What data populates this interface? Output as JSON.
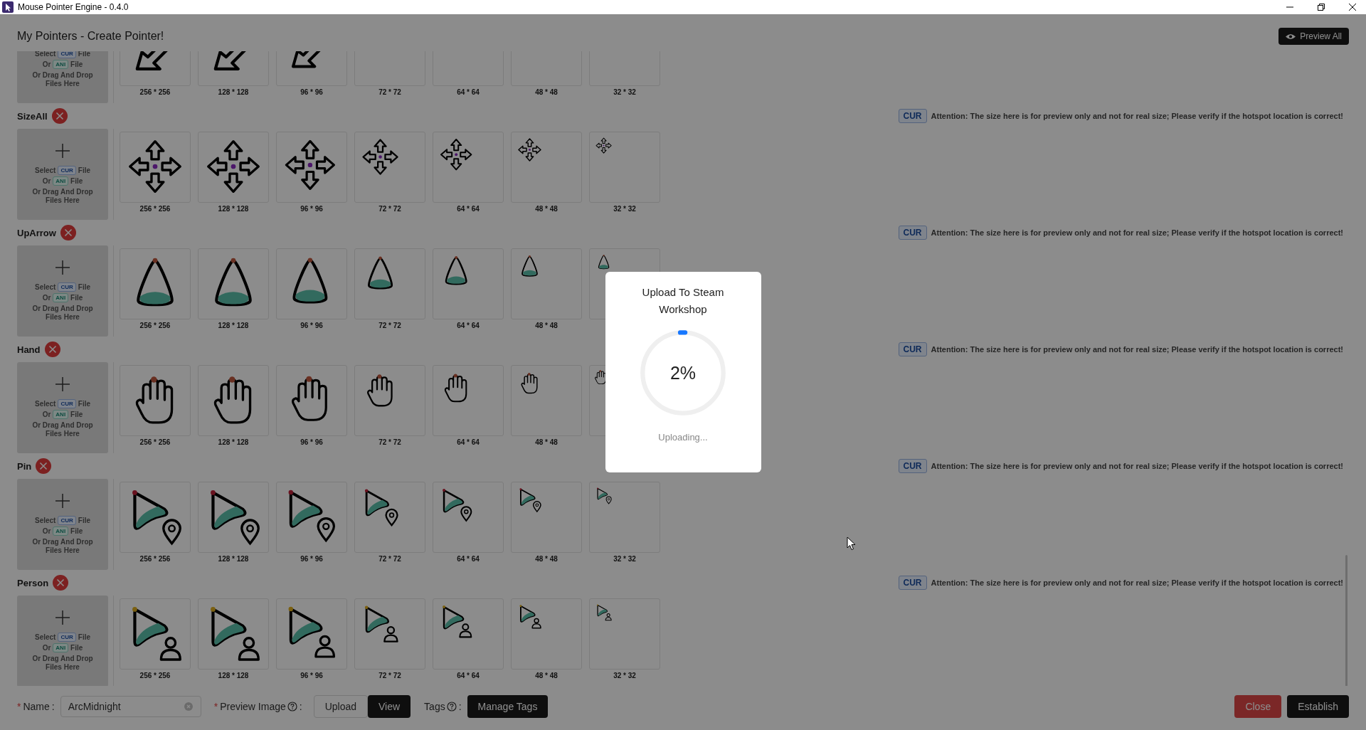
{
  "window": {
    "title": "Mouse Pointer Engine - 0.4.0"
  },
  "page": {
    "title": "My Pointers - Create Pointer!",
    "preview_button": "Preview All"
  },
  "sections": [
    {
      "kind": "arrow",
      "upload": {
        "select": "Select",
        "cur": "CUR",
        "file": "File",
        "or": "Or",
        "ani": "ANI",
        "file_2": "File",
        "drop": "Or Drag And Drop Files Here"
      },
      "sizes": [
        "256 * 256",
        "128 * 128",
        "96 * 96",
        "72 * 72",
        "64 * 64",
        "48 * 48",
        "32 * 32"
      ]
    },
    {
      "kind": "sizeall",
      "header": {
        "name": "SizeAll",
        "tag": "CUR",
        "notice": "Attention: The size here is for preview only and not for real size; Please verify if the hotspot location is correct!"
      },
      "upload": {
        "select": "Select",
        "cur": "CUR",
        "file": "File",
        "or": "Or",
        "ani": "ANI",
        "file_2": "File",
        "drop": "Or Drag And Drop Files Here"
      },
      "sizes": [
        "256 * 256",
        "128 * 128",
        "96 * 96",
        "72 * 72",
        "64 * 64",
        "48 * 48",
        "32 * 32"
      ]
    },
    {
      "kind": "uparrow",
      "header": {
        "name": "UpArrow",
        "tag": "CUR",
        "notice": "Attention: The size here is for preview only and not for real size; Please verify if the hotspot location is correct!"
      },
      "upload": {
        "select": "Select",
        "cur": "CUR",
        "file": "File",
        "or": "Or",
        "ani": "ANI",
        "file_2": "File",
        "drop": "Or Drag And Drop Files Here"
      },
      "sizes": [
        "256 * 256",
        "128 * 128",
        "96 * 96",
        "72 * 72",
        "64 * 64",
        "48 * 48"
      ],
      "extra_tile": true
    },
    {
      "kind": "hand",
      "header": {
        "name": "Hand",
        "tag": "CUR",
        "notice": "Attention: The size here is for preview only and not for real size; Please verify if the hotspot location is correct!"
      },
      "upload": {
        "select": "Select",
        "cur": "CUR",
        "file": "File",
        "or": "Or",
        "ani": "ANI",
        "file_2": "File",
        "drop": "Or Drag And Drop Files Here"
      },
      "sizes": [
        "256 * 256",
        "128 * 128",
        "96 * 96",
        "72 * 72",
        "64 * 64",
        "48 * 48"
      ],
      "extra_tile": true
    },
    {
      "kind": "pin",
      "header": {
        "name": "Pin",
        "tag": "CUR",
        "notice": "Attention: The size here is for preview only and not for real size; Please verify if the hotspot location is correct!"
      },
      "upload": {
        "select": "Select",
        "cur": "CUR",
        "file": "File",
        "or": "Or",
        "ani": "ANI",
        "file_2": "File",
        "drop": "Or Drag And Drop Files Here"
      },
      "sizes": [
        "256 * 256",
        "128 * 128",
        "96 * 96",
        "72 * 72",
        "64 * 64",
        "48 * 48",
        "32 * 32"
      ]
    },
    {
      "kind": "person",
      "header": {
        "name": "Person",
        "tag": "CUR",
        "notice": "Attention: The size here is for preview only and not for real size; Please verify if the hotspot location is correct!"
      },
      "upload": {
        "select": "Select",
        "cur": "CUR",
        "file": "File",
        "or": "Or",
        "ani": "ANI",
        "file_2": "File",
        "drop": "Or Drag And Drop Files Here"
      },
      "sizes": [
        "256 * 256",
        "128 * 128",
        "96 * 96",
        "72 * 72",
        "64 * 64",
        "48 * 48",
        "32 * 32"
      ]
    }
  ],
  "form": {
    "name": {
      "mark": "*",
      "label": "Name",
      "colon": ":",
      "value": "ArcMidnight"
    },
    "preview": {
      "mark": "*",
      "label": "Preview Image",
      "colon": ":",
      "upload_button": "Upload",
      "view_button": "View"
    },
    "tags": {
      "label": "Tags",
      "colon": ":",
      "button": "Manage Tags"
    },
    "close_button": "Close",
    "establish_button": "Establish"
  },
  "modal": {
    "title": "Upload To Steam Workshop",
    "level": 0.02,
    "percent": "2%",
    "status": "Uploading..."
  }
}
